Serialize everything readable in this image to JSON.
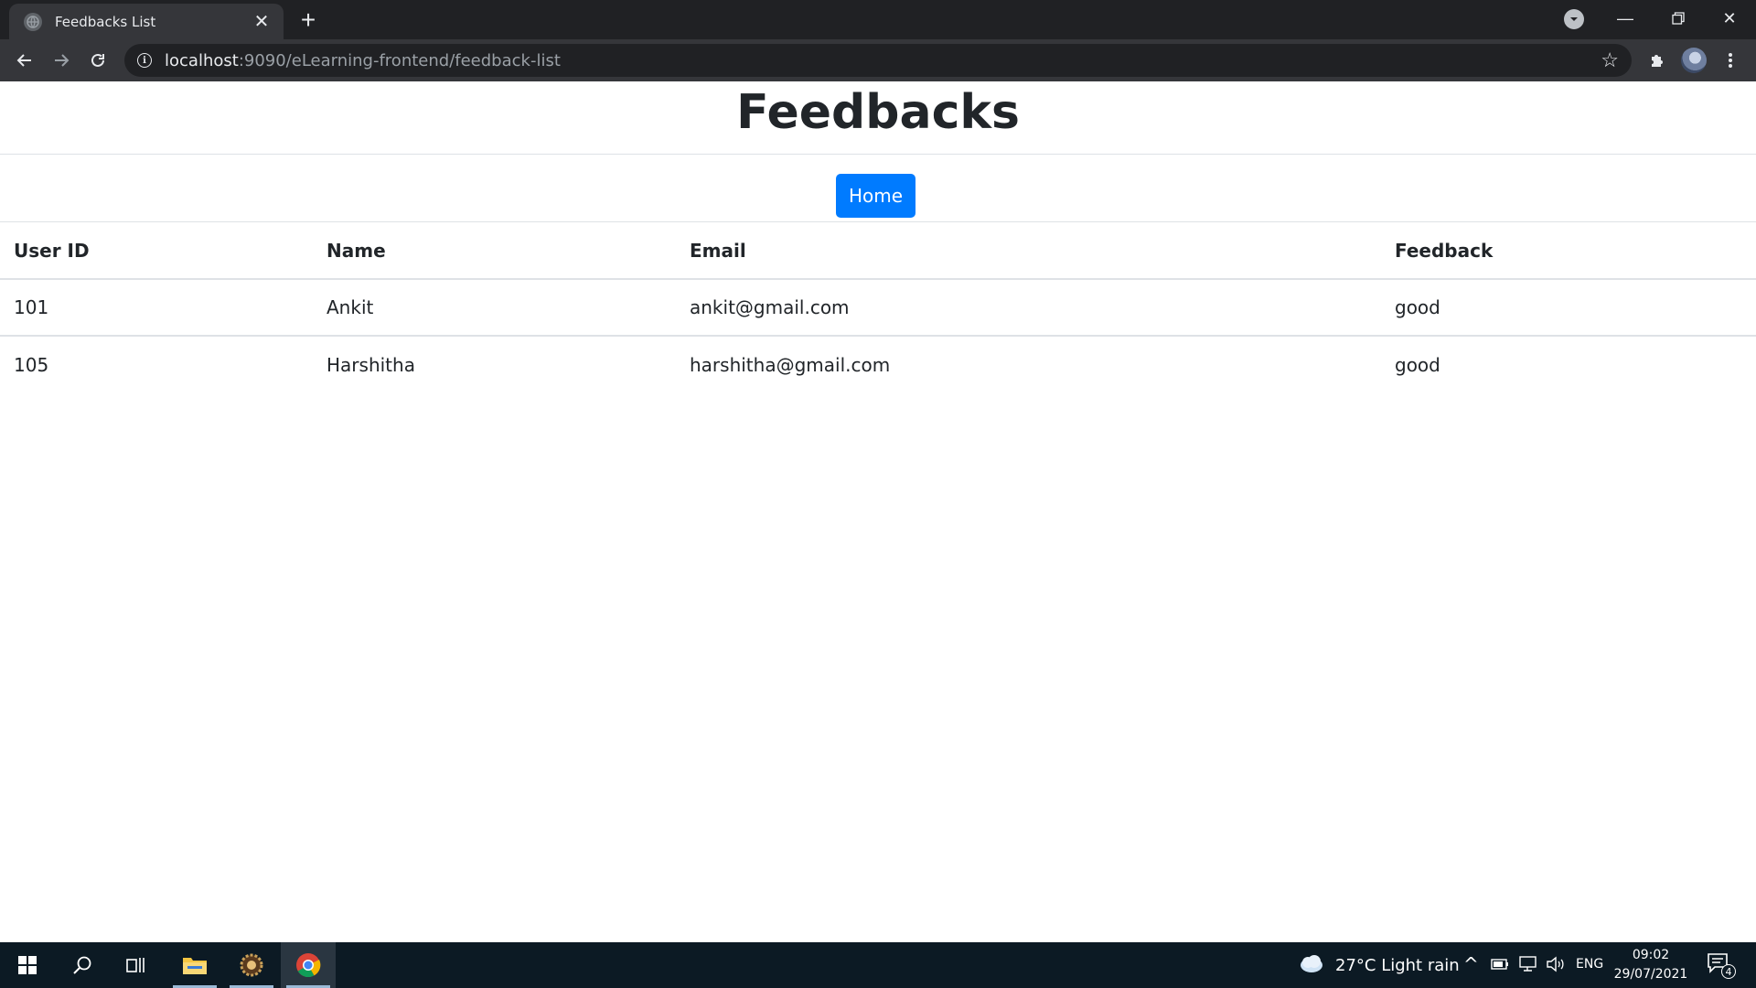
{
  "browser": {
    "tab_title": "Feedbacks List",
    "url_host": "localhost",
    "url_path": ":9090/eLearning-frontend/feedback-list"
  },
  "page": {
    "title": "Feedbacks",
    "home_button": "Home"
  },
  "table": {
    "headers": [
      "User ID",
      "Name",
      "Email",
      "Feedback"
    ],
    "rows": [
      [
        "101",
        "Ankit",
        "ankit@gmail.com",
        "good"
      ],
      [
        "105",
        "Harshitha",
        "harshitha@gmail.com",
        "good"
      ]
    ]
  },
  "taskbar": {
    "weather": "27°C  Light rain",
    "language": "ENG",
    "time": "09:02",
    "date": "29/07/2021",
    "notification_count": "4"
  },
  "colors": {
    "primary_button": "#007bff",
    "chrome_dark": "#202124",
    "taskbar": "#0c1a24"
  }
}
